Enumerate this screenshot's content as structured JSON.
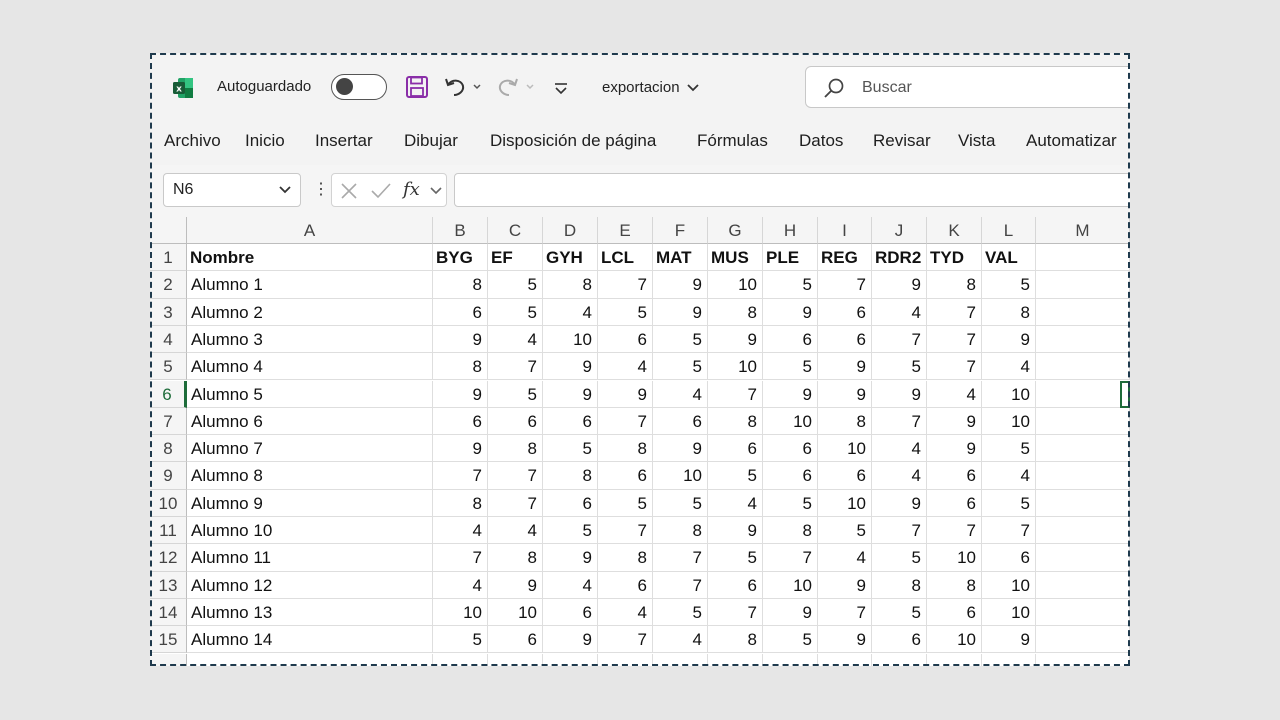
{
  "app": {
    "autosave_label": "Autoguardado",
    "filename": "exportacion",
    "search_placeholder": "Buscar",
    "brand_color": "#107c41"
  },
  "ribbon": {
    "tabs": [
      "Archivo",
      "Inicio",
      "Insertar",
      "Dibujar",
      "Disposición de página",
      "Fórmulas",
      "Datos",
      "Revisar",
      "Vista",
      "Automatizar"
    ]
  },
  "formula_bar": {
    "name_box": "N6",
    "formula": ""
  },
  "sheet": {
    "columns": [
      "A",
      "B",
      "C",
      "D",
      "E",
      "F",
      "G",
      "H",
      "I",
      "J",
      "K",
      "L",
      "M"
    ],
    "header_row": [
      "Nombre",
      "BYG",
      "EF",
      "GYH",
      "LCL",
      "MAT",
      "MUS",
      "PLE",
      "REG",
      "RDR2",
      "TYD",
      "VAL"
    ],
    "row_numbers": [
      "1",
      "2",
      "3",
      "4",
      "5",
      "6",
      "7",
      "8",
      "9",
      "10",
      "11",
      "12",
      "13",
      "14",
      "15"
    ],
    "rows": [
      [
        "Alumno 1",
        8,
        5,
        8,
        7,
        9,
        10,
        5,
        7,
        9,
        8,
        5
      ],
      [
        "Alumno 2",
        6,
        5,
        4,
        5,
        9,
        8,
        9,
        6,
        4,
        7,
        8
      ],
      [
        "Alumno 3",
        9,
        4,
        10,
        6,
        5,
        9,
        6,
        6,
        7,
        7,
        9
      ],
      [
        "Alumno 4",
        8,
        7,
        9,
        4,
        5,
        10,
        5,
        9,
        5,
        7,
        4
      ],
      [
        "Alumno 5",
        9,
        5,
        9,
        9,
        4,
        7,
        9,
        9,
        9,
        4,
        10
      ],
      [
        "Alumno 6",
        6,
        6,
        6,
        7,
        6,
        8,
        10,
        8,
        7,
        9,
        10
      ],
      [
        "Alumno 7",
        9,
        8,
        5,
        8,
        9,
        6,
        6,
        10,
        4,
        9,
        5
      ],
      [
        "Alumno 8",
        7,
        7,
        8,
        6,
        10,
        5,
        6,
        6,
        4,
        6,
        4
      ],
      [
        "Alumno 9",
        8,
        7,
        6,
        5,
        5,
        4,
        5,
        10,
        9,
        6,
        5
      ],
      [
        "Alumno 10",
        4,
        4,
        5,
        7,
        8,
        9,
        8,
        5,
        7,
        7,
        7
      ],
      [
        "Alumno 11",
        7,
        8,
        9,
        8,
        7,
        5,
        7,
        4,
        5,
        10,
        6
      ],
      [
        "Alumno 12",
        4,
        9,
        4,
        6,
        7,
        6,
        10,
        9,
        8,
        8,
        10
      ],
      [
        "Alumno 13",
        10,
        10,
        6,
        4,
        5,
        7,
        9,
        7,
        5,
        6,
        10
      ],
      [
        "Alumno 14",
        5,
        6,
        9,
        7,
        4,
        8,
        5,
        9,
        6,
        10,
        9
      ]
    ],
    "active_row": "6"
  }
}
